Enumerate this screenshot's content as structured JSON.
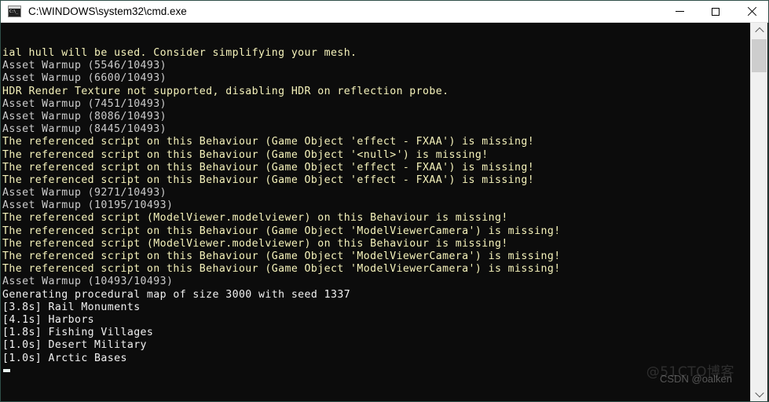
{
  "window": {
    "title": "C:\\WINDOWS\\system32\\cmd.exe",
    "icon": "cmd-console-icon",
    "controls": {
      "minimize": "minimize",
      "maximize": "maximize",
      "close": "close"
    },
    "colors": {
      "background": "#0c0c0c",
      "titlebar": "#ffffff",
      "warning_text": "#f6f3bb",
      "info_text": "#cccccc",
      "plain_text": "#f2f2f2",
      "border": "#2f4f48",
      "scrollbar_track": "#f0f0f0",
      "scrollbar_thumb": "#cdcdcd"
    }
  },
  "console": {
    "lines": [
      {
        "text": "ial hull will be used. Consider simplifying your mesh.",
        "style": "warn"
      },
      {
        "text": "Asset Warmup (5546/10493)",
        "style": "info"
      },
      {
        "text": "Asset Warmup (6600/10493)",
        "style": "info"
      },
      {
        "text": "HDR Render Texture not supported, disabling HDR on reflection probe.",
        "style": "warn"
      },
      {
        "text": "Asset Warmup (7451/10493)",
        "style": "info"
      },
      {
        "text": "Asset Warmup (8086/10493)",
        "style": "info"
      },
      {
        "text": "Asset Warmup (8445/10493)",
        "style": "info"
      },
      {
        "text": "The referenced script on this Behaviour (Game Object 'effect - FXAA') is missing!",
        "style": "warn"
      },
      {
        "text": "The referenced script on this Behaviour (Game Object '<null>') is missing!",
        "style": "warn"
      },
      {
        "text": "The referenced script on this Behaviour (Game Object 'effect - FXAA') is missing!",
        "style": "warn"
      },
      {
        "text": "The referenced script on this Behaviour (Game Object 'effect - FXAA') is missing!",
        "style": "warn"
      },
      {
        "text": "Asset Warmup (9271/10493)",
        "style": "info"
      },
      {
        "text": "Asset Warmup (10195/10493)",
        "style": "info"
      },
      {
        "text": "The referenced script (ModelViewer.modelviewer) on this Behaviour is missing!",
        "style": "warn"
      },
      {
        "text": "The referenced script on this Behaviour (Game Object 'ModelViewerCamera') is missing!",
        "style": "warn"
      },
      {
        "text": "The referenced script (ModelViewer.modelviewer) on this Behaviour is missing!",
        "style": "warn"
      },
      {
        "text": "The referenced script on this Behaviour (Game Object 'ModelViewerCamera') is missing!",
        "style": "warn"
      },
      {
        "text": "The referenced script on this Behaviour (Game Object 'ModelViewerCamera') is missing!",
        "style": "warn"
      },
      {
        "text": "Asset Warmup (10493/10493)",
        "style": "info"
      },
      {
        "text": "Generating procedural map of size 3000 with seed 1337",
        "style": "plain"
      },
      {
        "text": "[3.8s] Rail Monuments",
        "style": "plain"
      },
      {
        "text": "[4.1s] Harbors",
        "style": "plain"
      },
      {
        "text": "[1.8s] Fishing Villages",
        "style": "plain"
      },
      {
        "text": "[1.0s] Desert Military",
        "style": "plain"
      },
      {
        "text": "[1.0s] Arctic Bases",
        "style": "plain"
      }
    ],
    "cursor": "_"
  },
  "watermarks": {
    "primary": "@51CTO博客",
    "secondary": "CSDN @oalken"
  },
  "scrollbar": {
    "up_arrow": "scroll-up",
    "down_arrow": "scroll-down",
    "thumb": "scroll-thumb"
  }
}
